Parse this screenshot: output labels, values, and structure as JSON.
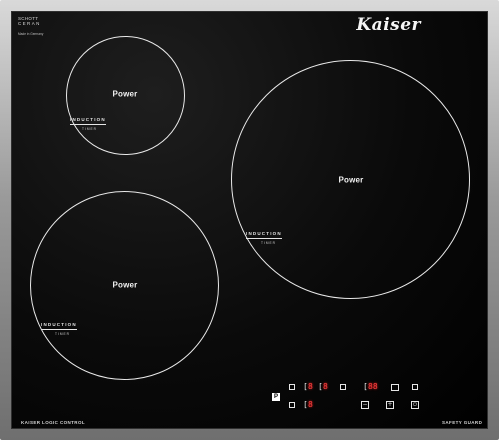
{
  "brand": {
    "logo_text": "Kaiser"
  },
  "glass_marks": {
    "schott_line1": "SCHOTT",
    "schott_line2": "CERAN",
    "made_in": "Made in Germany"
  },
  "zones": [
    {
      "id": "small-top-left",
      "label": "Power",
      "induction": "INDUCTION",
      "timer": "TIMER"
    },
    {
      "id": "large-right",
      "label": "Power",
      "induction": "INDUCTION",
      "timer": "TIMER"
    },
    {
      "id": "medium-bottom-left",
      "label": "Power",
      "induction": "INDUCTION",
      "timer": "TIMER"
    }
  ],
  "footer": {
    "left_label": "KAISER LOGIC CONTROL",
    "right_label": "SAFETY GUARD"
  },
  "controls": {
    "pause_label": "P",
    "display_1": "8",
    "display_2": "8",
    "display_3": "8",
    "timer_display": "88",
    "minus_symbol": "−",
    "plus_symbol": "+",
    "power_symbol": "⏻",
    "key_symbol": "⚿"
  },
  "colors": {
    "glass": "#0a0a0a",
    "frame": "#9a9a9a",
    "markings": "#e9e9e9",
    "display_red": "#ff4040"
  }
}
